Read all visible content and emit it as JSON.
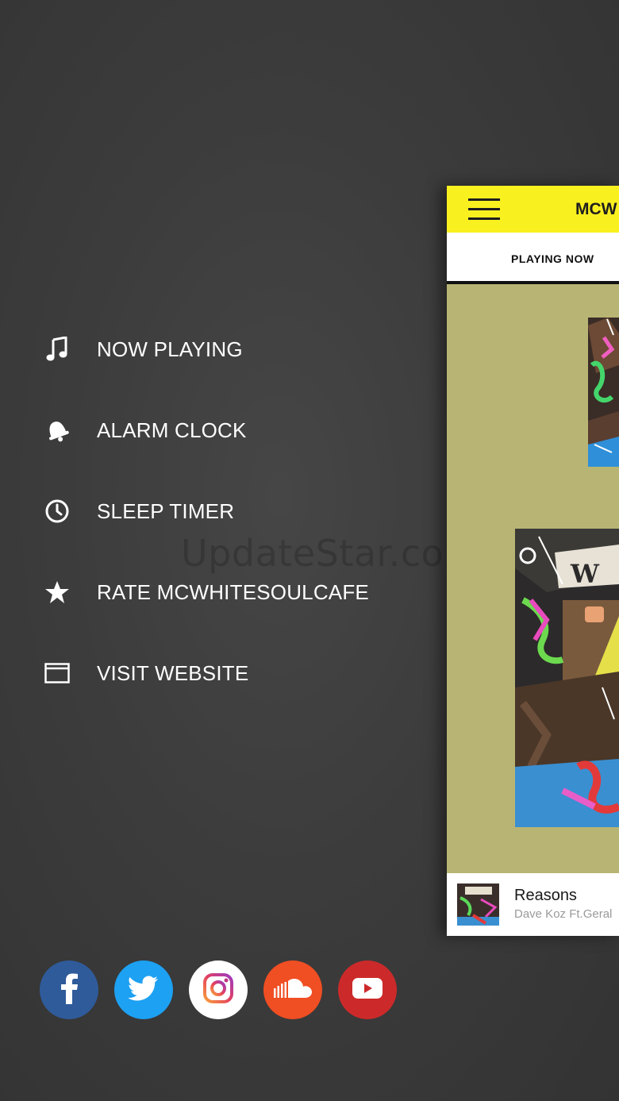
{
  "menu": {
    "items": [
      {
        "label": "NOW PLAYING",
        "icon": "music-note-icon"
      },
      {
        "label": "ALARM CLOCK",
        "icon": "bell-icon"
      },
      {
        "label": "SLEEP TIMER",
        "icon": "clock-icon"
      },
      {
        "label": "RATE MCWHITESOULCAFE",
        "icon": "star-icon"
      },
      {
        "label": "VISIT WEBSITE",
        "icon": "browser-window-icon"
      }
    ]
  },
  "watermark": "UpdateStar.com",
  "social": [
    {
      "name": "facebook",
      "color": "#2f5b9a"
    },
    {
      "name": "twitter",
      "color": "#1da1f2"
    },
    {
      "name": "instagram",
      "color": "#ffffff"
    },
    {
      "name": "soundcloud",
      "color": "#f04e23"
    },
    {
      "name": "youtube",
      "color": "#cc2a2a"
    }
  ],
  "panel": {
    "title": "MCW",
    "tab": "PLAYING NOW",
    "accent": "#f9f01f",
    "background": "#b8b574"
  },
  "player": {
    "song": "Reasons",
    "artist": "Dave Koz Ft.Geral"
  }
}
